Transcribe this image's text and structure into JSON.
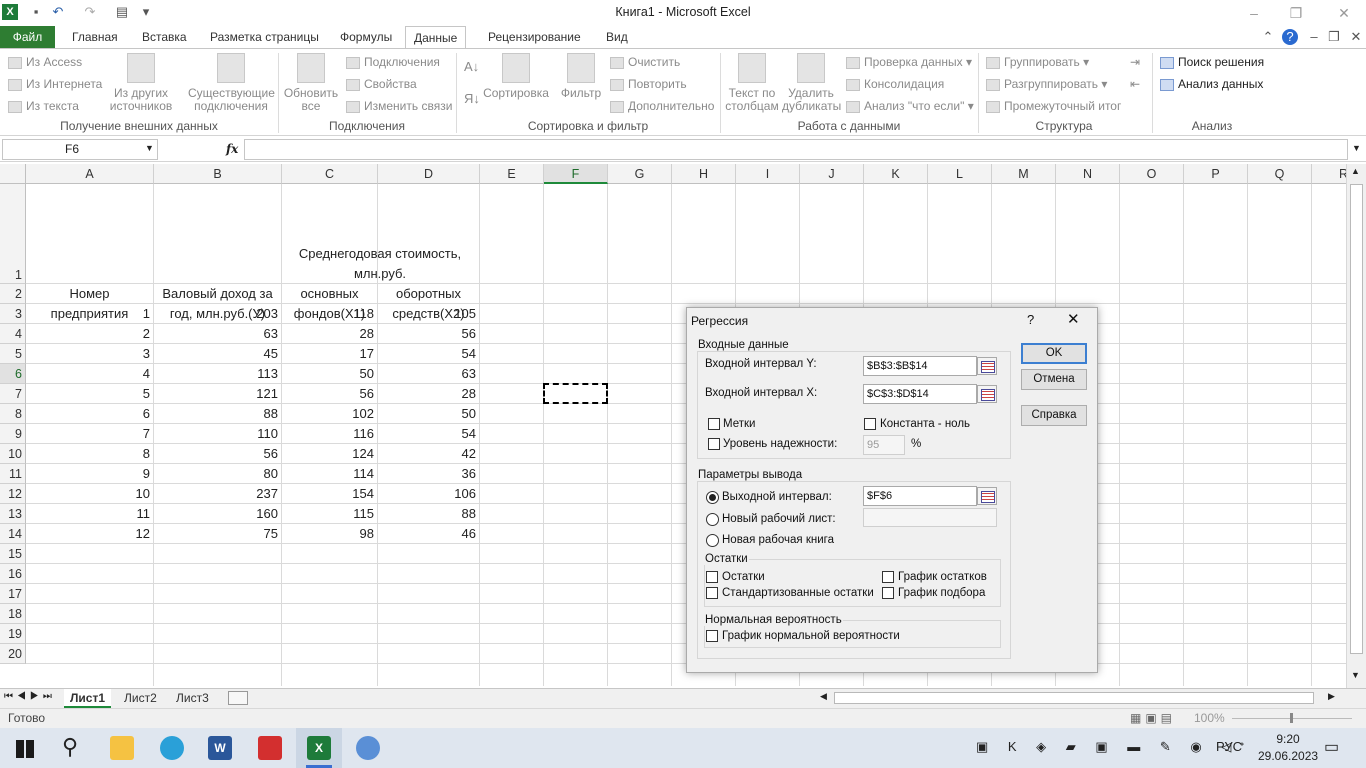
{
  "window": {
    "title": "Книга1 - Microsoft Excel"
  },
  "ribbon_tabs": [
    "Файл",
    "Главная",
    "Вставка",
    "Разметка страницы",
    "Формулы",
    "Данные",
    "Рецензирование",
    "Вид"
  ],
  "ribbon": {
    "get_external": {
      "access": "Из Access",
      "web": "Из Интернета",
      "text": "Из текста",
      "other_sources_line1": "Из других",
      "other_sources_line2": "источников",
      "existing_line1": "Существующие",
      "existing_line2": "подключения",
      "label": "Получение внешних данных"
    },
    "connections": {
      "refresh_line1": "Обновить",
      "refresh_line2": "все",
      "connections": "Подключения",
      "properties": "Свойства",
      "edit_links": "Изменить связи",
      "label": "Подключения"
    },
    "sort_filter": {
      "sort": "Сортировка",
      "filter": "Фильтр",
      "clear": "Очистить",
      "reapply": "Повторить",
      "advanced": "Дополнительно",
      "label": "Сортировка и фильтр"
    },
    "data_tools": {
      "text_to_cols_line1": "Текст по",
      "text_to_cols_line2": "столбцам",
      "remove_dup_line1": "Удалить",
      "remove_dup_line2": "дубликаты",
      "validation": "Проверка данных",
      "consolidate": "Консолидация",
      "whatif": "Анализ \"что если\"",
      "label": "Работа с данными"
    },
    "outline": {
      "group": "Группировать",
      "ungroup": "Разгруппировать",
      "subtotal": "Промежуточный итог",
      "label": "Структура"
    },
    "analysis": {
      "solver": "Поиск решения",
      "data_analysis": "Анализ данных",
      "label": "Анализ"
    }
  },
  "formula_bar": {
    "name_box": "F6",
    "fx": "fx",
    "formula": ""
  },
  "columns": [
    "A",
    "B",
    "C",
    "D",
    "E",
    "F",
    "G",
    "H",
    "I",
    "J",
    "K",
    "L",
    "M",
    "N",
    "O",
    "P",
    "Q",
    "R"
  ],
  "rows": [
    "1",
    "2",
    "3",
    "4",
    "5",
    "6",
    "7",
    "8",
    "9",
    "10",
    "11",
    "12",
    "13",
    "14",
    "15",
    "16",
    "17",
    "18",
    "19",
    "20"
  ],
  "headers": {
    "c1_line1": "Среднегодовая стоимость,",
    "c1_line2": "млн.руб.",
    "a2_line1": "Номер",
    "a2_line2": "предприятия",
    "b2_line1": "Валовый доход за",
    "b2_line2": "год, млн.руб.(У)",
    "c2_line1": "основных",
    "c2_line2": "фондов(Х1)",
    "d2_line1": "оборотных",
    "d2_line2": "средств(Х2)"
  },
  "table": [
    [
      "1",
      "203",
      "118",
      "105"
    ],
    [
      "2",
      "63",
      "28",
      "56"
    ],
    [
      "3",
      "45",
      "17",
      "54"
    ],
    [
      "4",
      "113",
      "50",
      "63"
    ],
    [
      "5",
      "121",
      "56",
      "28"
    ],
    [
      "6",
      "88",
      "102",
      "50"
    ],
    [
      "7",
      "110",
      "116",
      "54"
    ],
    [
      "8",
      "56",
      "124",
      "42"
    ],
    [
      "9",
      "80",
      "114",
      "36"
    ],
    [
      "10",
      "237",
      "154",
      "106"
    ],
    [
      "11",
      "160",
      "115",
      "88"
    ],
    [
      "12",
      "75",
      "98",
      "46"
    ]
  ],
  "sheets": [
    "Лист1",
    "Лист2",
    "Лист3"
  ],
  "status": {
    "ready": "Готово",
    "zoom": "100%"
  },
  "taskbar": {
    "lang": "РУС",
    "time": "9:20",
    "date": "29.06.2023"
  },
  "dialog": {
    "title": "Регрессия",
    "help_glyph": "?",
    "input_group": "Входные данные",
    "input_y_label": "Входной интервал Y:",
    "input_y_value": "$B$3:$B$14",
    "input_x_label": "Входной интервал X:",
    "input_x_value": "$C$3:$D$14",
    "labels_chk": "Метки",
    "const_zero_chk": "Константа - ноль",
    "confidence_chk": "Уровень надежности:",
    "confidence_value": "95",
    "percent": "%",
    "output_group": "Параметры вывода",
    "output_range_label": "Выходной интервал:",
    "output_range_value": "$F$6",
    "new_sheet_label": "Новый рабочий лист:",
    "new_book_label": "Новая рабочая книга",
    "residuals_group": "Остатки",
    "residuals_chk": "Остатки",
    "std_residuals_chk": "Стандартизованные остатки",
    "residual_plot_chk": "График остатков",
    "fit_plot_chk": "График подбора",
    "normal_group": "Нормальная вероятность",
    "normal_plot_chk": "График нормальной вероятности",
    "ok": "OK",
    "cancel": "Отмена",
    "help": "Справка"
  },
  "colors": {
    "excel_green": "#1e8a3a",
    "file_tab": "#2e7d32",
    "selection_border": "#000000",
    "dialog_bg": "#f0f0f0"
  }
}
